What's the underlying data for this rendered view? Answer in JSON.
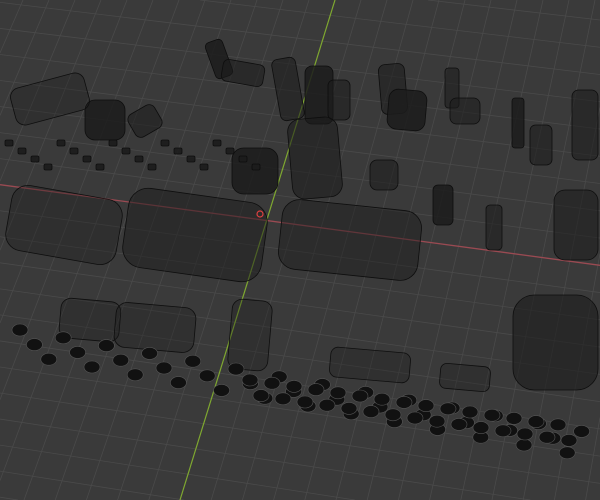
{
  "viewport": {
    "background": "#3a3a3a",
    "grid_color": "#4a4a4a",
    "x_axis_color": "#9a4a52",
    "y_axis_color": "#7fa830",
    "object_fill": "#1c1c1c",
    "wire_color": "#0e0e0e",
    "selected_origin_color": "#e04040"
  }
}
